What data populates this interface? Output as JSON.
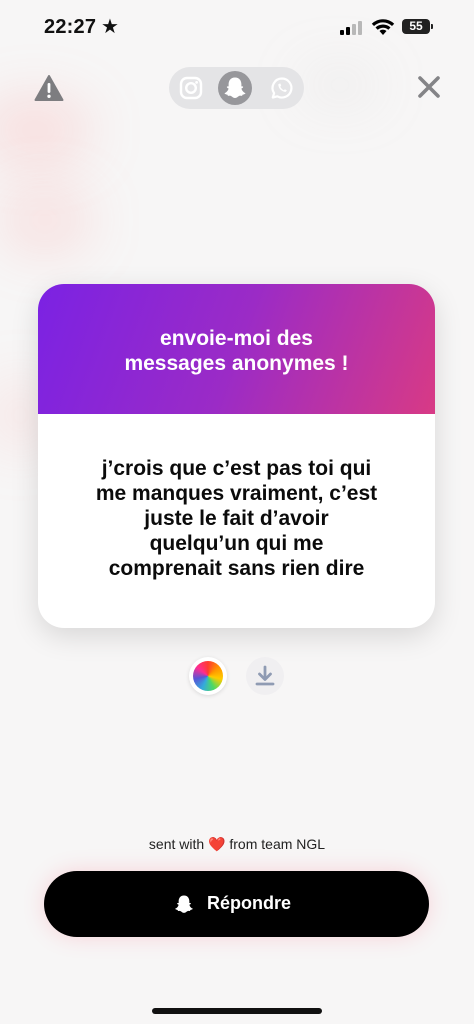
{
  "status_bar": {
    "time": "22:27",
    "star_glyph": "★",
    "battery": "55"
  },
  "toolbar": {
    "warn_icon": "warning-triangle-icon",
    "close_icon": "close-icon",
    "share_options": [
      {
        "icon": "instagram-icon",
        "selected": false
      },
      {
        "icon": "snapchat-ghost-icon",
        "selected": true
      },
      {
        "icon": "whatsapp-icon",
        "selected": false
      }
    ]
  },
  "card": {
    "title_line1": "envoie-moi des",
    "title_line2": "messages anonymes !",
    "message_lines": [
      "j’crois que c’est pas toi qui",
      "me manques vraiment, c’est",
      "juste le fait d’avoir",
      "quelqu’un qui me",
      "comprenait sans rien dire"
    ],
    "gradient_colors": [
      "#7b22e3",
      "#d83a85"
    ]
  },
  "actions": {
    "color_icon": "color-wheel-icon",
    "download_icon": "download-icon"
  },
  "footer": {
    "prefix": "sent with",
    "heart": "❤️",
    "suffix": "from team NGL"
  },
  "reply_button": {
    "label": "Répondre",
    "icon": "snapchat-ghost-icon"
  }
}
